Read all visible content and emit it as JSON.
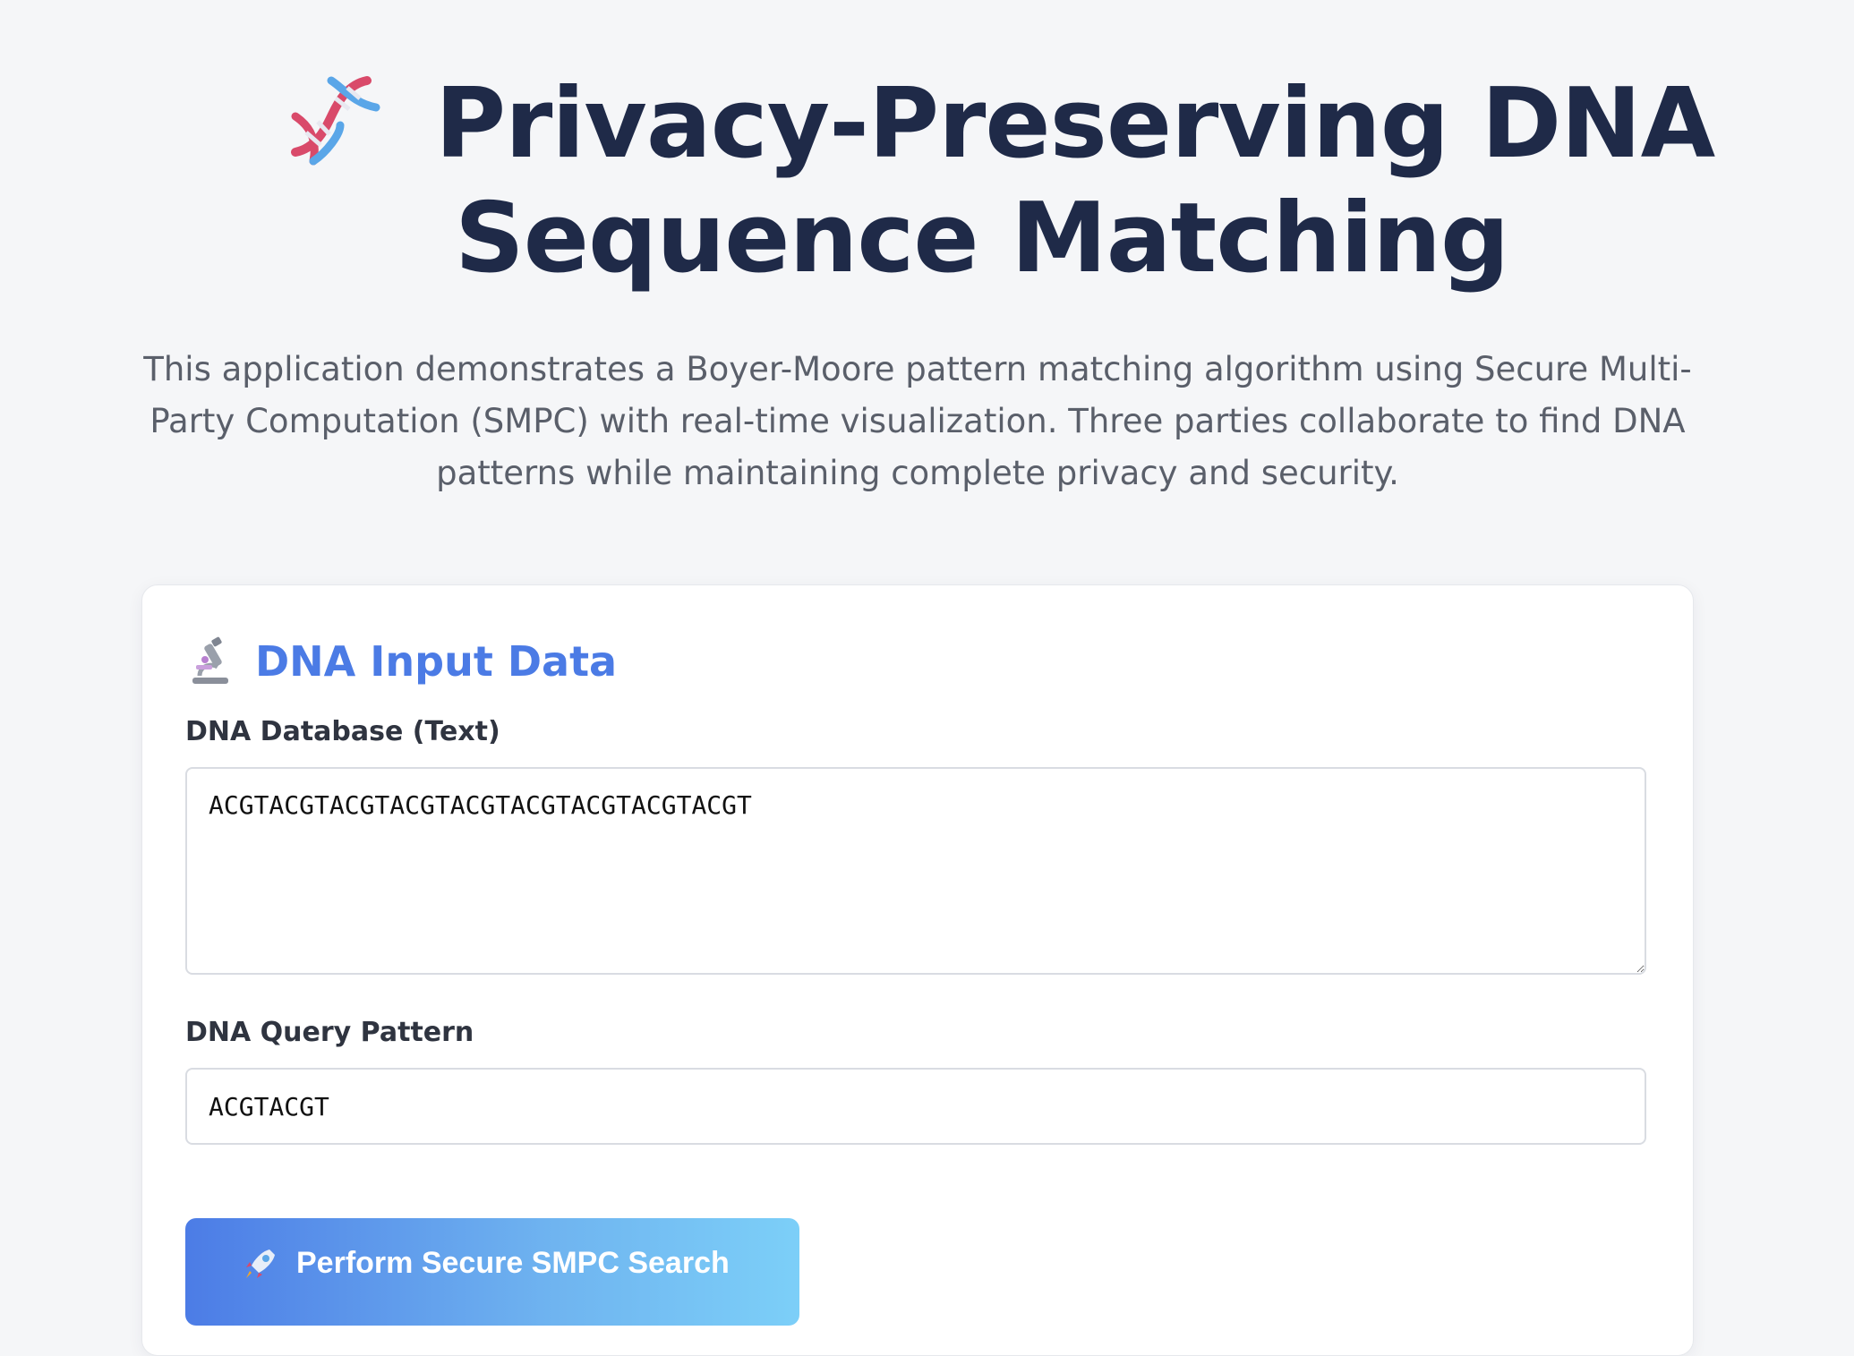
{
  "header": {
    "title_line1": "Privacy-Preserving DNA",
    "title_line2": "Sequence Matching",
    "icon": "dna-icon",
    "subtitle": "This application demonstrates a Boyer-Moore pattern matching algorithm using Secure Multi-Party Computation (SMPC) with real-time visualization. Three parties collaborate to find DNA patterns while maintaining complete privacy and security."
  },
  "input_card": {
    "icon": "microscope-icon",
    "title": "DNA Input Data",
    "database_label": "DNA Database (Text)",
    "database_value": "ACGTACGTACGTACGTACGTACGTACGTACGTACGT",
    "query_label": "DNA Query Pattern",
    "query_value": "ACGTACGT",
    "search_button": {
      "icon": "rocket-icon",
      "label": "Perform Secure SMPC Search"
    }
  },
  "colors": {
    "background": "#f5f6f8",
    "title": "#1f2a48",
    "accent": "#4b7be5",
    "button_gradient_start": "#4c7ce6",
    "button_gradient_end": "#7ccff8"
  }
}
